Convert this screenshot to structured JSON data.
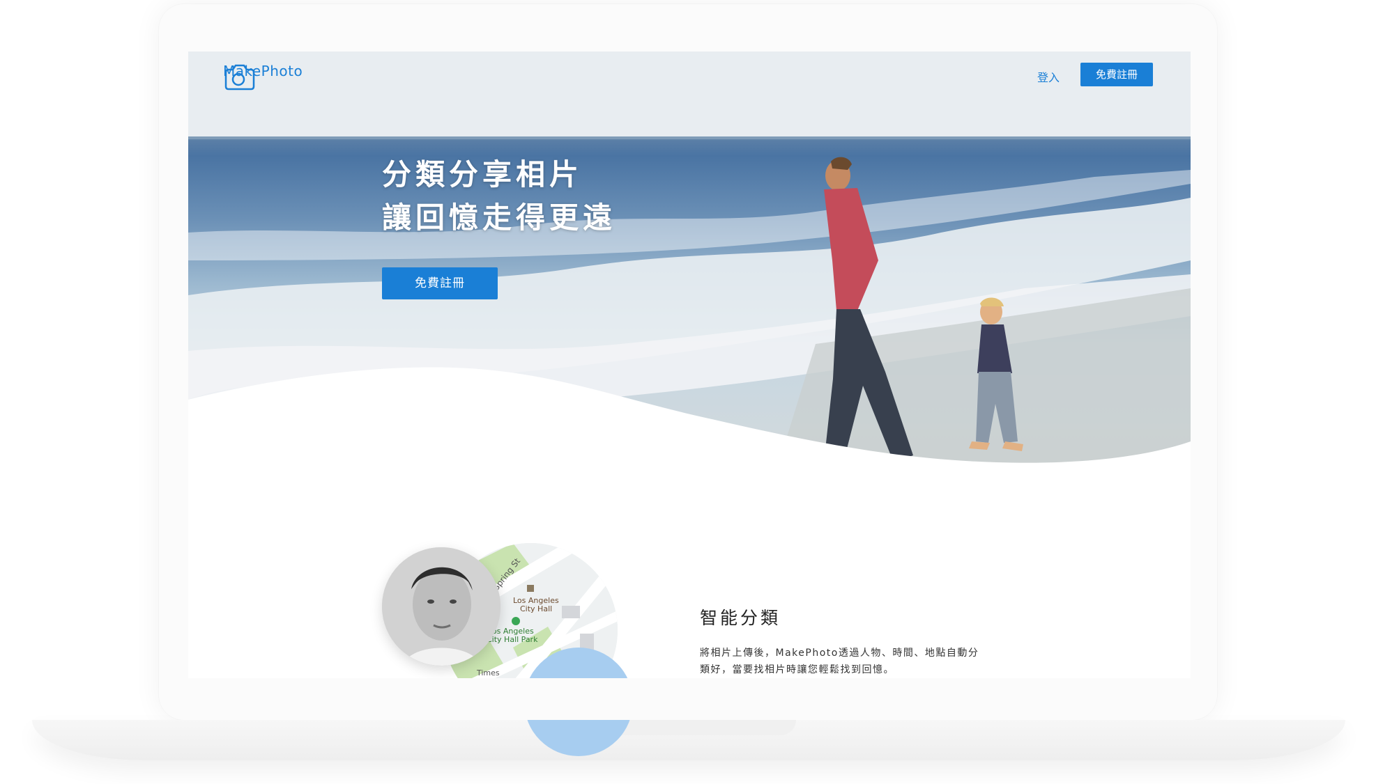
{
  "brand": {
    "name": "MakePhoto",
    "color": "#1a7fd6"
  },
  "nav": {
    "login": "登入",
    "signup": "免費註冊"
  },
  "hero": {
    "headline_line1": "分類分享相片",
    "headline_line2": "讓回憶走得更遠",
    "cta": "免費註冊"
  },
  "feature": {
    "title": "智能分類",
    "desc_line1": "將相片上傳後，MakePhoto透過人物、時間、地點自動分",
    "desc_line2": "類好，當要找相片時讓您輕鬆找到回憶。"
  },
  "map_labels": {
    "street": "S Spring St",
    "city_hall_1": "Los Angeles",
    "city_hall_2": "City Hall",
    "park_1": "Los Angeles",
    "park_2": "City Hall Park",
    "times": "Times"
  }
}
